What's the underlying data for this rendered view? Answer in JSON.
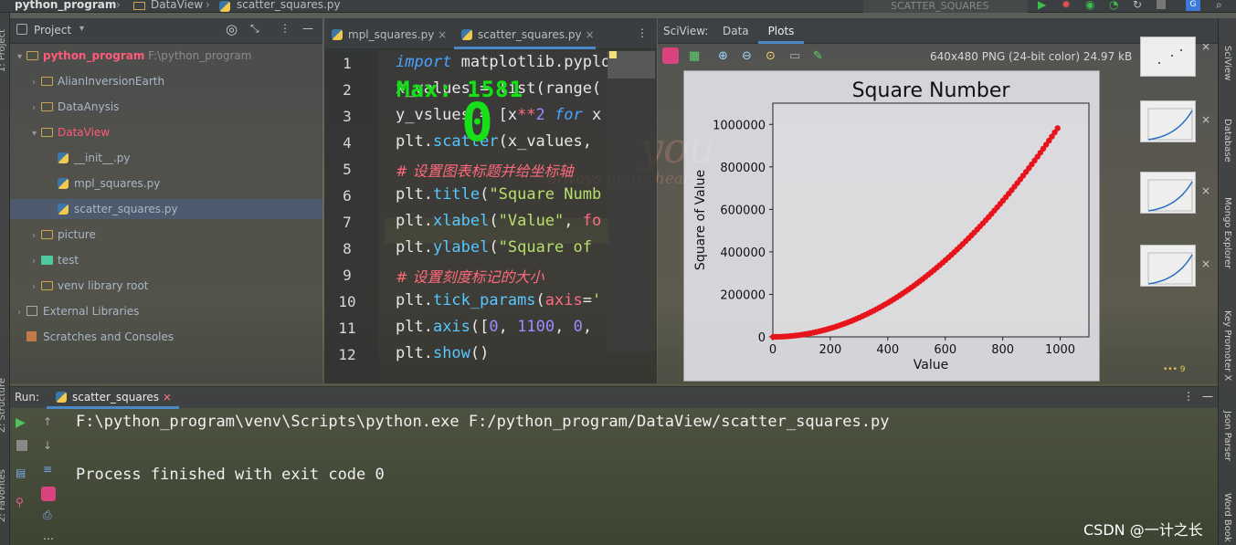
{
  "topbar": {
    "project_name": "python_program",
    "crumb1": "DataView",
    "crumb2": "scatter_squares.py",
    "run_config": "SCATTER_SQUARES"
  },
  "left_stripe": {
    "project": "1: Project",
    "structure": "Z: Structure",
    "favorites": "2: Favorites"
  },
  "project_panel": {
    "title": "Project",
    "items": [
      {
        "label": "python_program",
        "suffix": "F:\\python_program"
      },
      {
        "label": "AlianInversionEarth"
      },
      {
        "label": "DataAnysis"
      },
      {
        "label": "DataView"
      },
      {
        "label": "__init__.py"
      },
      {
        "label": "mpl_squares.py"
      },
      {
        "label": "scatter_squares.py"
      },
      {
        "label": "picture"
      },
      {
        "label": "test"
      },
      {
        "label": "venv  library root"
      },
      {
        "label": "External Libraries"
      },
      {
        "label": "Scratches and Consoles"
      }
    ]
  },
  "editor": {
    "tabs": [
      {
        "label": "mpl_squares.py"
      },
      {
        "label": "scatter_squares.py"
      }
    ],
    "line_numbers": [
      "1",
      "2",
      "3",
      "4",
      "5",
      "6",
      "7",
      "8",
      "9",
      "10",
      "11",
      "12"
    ],
    "overlay_text": "Max: 1581",
    "overlay_digit": "0"
  },
  "sciview": {
    "label": "SciView:",
    "tabs": [
      {
        "label": "Data"
      },
      {
        "label": "Plots"
      }
    ],
    "image_info": "640x480 PNG (24-bit color) 24.97 kB",
    "more": "••• 9"
  },
  "chart_data": {
    "type": "scatter",
    "title": "Square Number",
    "xlabel": "Value",
    "ylabel": "Square of Value",
    "xlim": [
      0,
      1100
    ],
    "ylim": [
      0,
      1100000
    ],
    "xticks": [
      0,
      200,
      400,
      600,
      800,
      1000
    ],
    "yticks": [
      0,
      200000,
      400000,
      600000,
      800000,
      1000000
    ],
    "series": [
      {
        "x_range": [
          1,
          1000
        ],
        "function": "y = x^2",
        "color": "#e8141c"
      }
    ]
  },
  "right_stripe": {
    "items": [
      "SciView",
      "Database",
      "Mongo Explorer",
      "Key Promoter X",
      "Json Parser",
      "Word Book"
    ]
  },
  "run_panel": {
    "label": "Run:",
    "tab": "scatter_squares",
    "lines": [
      "F:\\python_program\\venv\\Scripts\\python.exe F:/python_program/DataView/scatter_squares.py",
      "",
      "Process finished with exit code 0"
    ]
  },
  "watermark": "CSDN @一计之长",
  "deco_text": {
    "big": "you",
    "small": "always in my heart"
  }
}
